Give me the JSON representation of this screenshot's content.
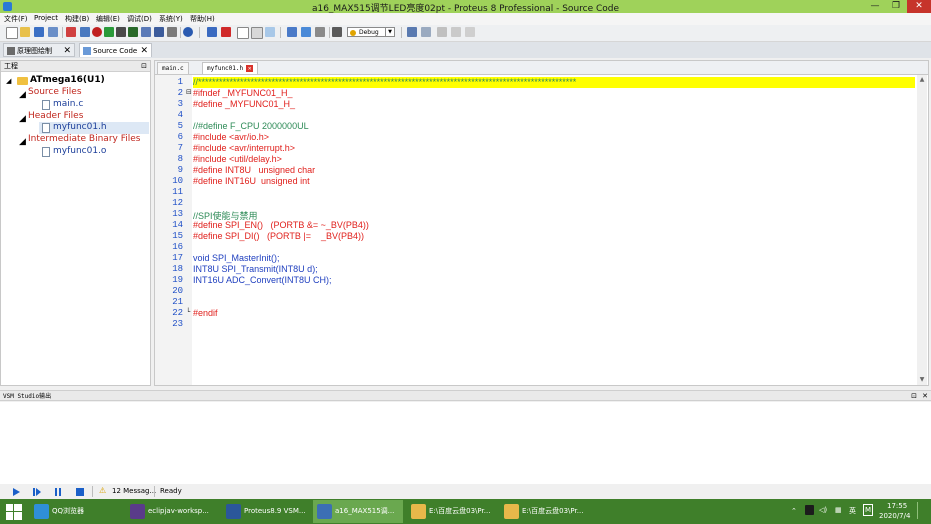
{
  "window": {
    "title": "a16_MAX515调节LED亮度02pt - Proteus 8 Professional - Source Code",
    "minimize": "—",
    "maximize": "❐",
    "close": "✕"
  },
  "menu": [
    "文件(F)",
    "Project",
    "构建(B)",
    "编辑(E)",
    "调试(D)",
    "系统(Y)",
    "帮助(H)"
  ],
  "toolbar": {
    "config": "Debug"
  },
  "doc_tabs": [
    {
      "label": "原理图绘制",
      "close": "✕"
    },
    {
      "label": "Source Code",
      "close": "✕"
    }
  ],
  "project": {
    "header": "工程",
    "pin": "⊡",
    "root": "ATmega16(U1)",
    "groups": [
      {
        "label": "Source Files",
        "files": [
          "main.c"
        ]
      },
      {
        "label": "Header Files",
        "files": [
          "myfunc01.h"
        ]
      },
      {
        "label": "Intermediate Binary Files",
        "files": [
          "myfunc01.o"
        ]
      }
    ]
  },
  "editor": {
    "tabs": [
      {
        "label": "main.c"
      },
      {
        "label": "myfunc01.h",
        "close": "✕"
      }
    ],
    "lines": [
      {
        "n": "1",
        "text": "//************************************************************************************************************",
        "color": "#2e8b57"
      },
      {
        "n": "2",
        "text": "#ifndef _MYFUNC01_H_",
        "color": "#e0201c"
      },
      {
        "n": "3",
        "text": "#define _MYFUNC01_H_",
        "color": "#e0201c"
      },
      {
        "n": "4",
        "text": "",
        "color": "#000000"
      },
      {
        "n": "5",
        "text": "//#define F_CPU 2000000UL",
        "color": "#2e8b57"
      },
      {
        "n": "6",
        "text": "#include <avr/io.h>",
        "color": "#e0201c"
      },
      {
        "n": "7",
        "text": "#include <avr/interrupt.h>",
        "color": "#e0201c"
      },
      {
        "n": "8",
        "text": "#include <util/delay.h>",
        "color": "#e0201c"
      },
      {
        "n": "9",
        "text": "#define INT8U   unsigned char",
        "color": "#e0201c"
      },
      {
        "n": "10",
        "text": "#define INT16U  unsigned int",
        "color": "#e0201c"
      },
      {
        "n": "11",
        "text": "",
        "color": "#000000"
      },
      {
        "n": "12",
        "text": "",
        "color": "#000000"
      },
      {
        "n": "13",
        "text": "//SPI使能与禁用",
        "color": "#2e8b57"
      },
      {
        "n": "14",
        "text": "#define SPI_EN()   (PORTB &= ~_BV(PB4))",
        "color": "#e0201c"
      },
      {
        "n": "15",
        "text": "#define SPI_DI()   (PORTB |=    _BV(PB4))",
        "color": "#e0201c"
      },
      {
        "n": "16",
        "text": "",
        "color": "#000000"
      },
      {
        "n": "17",
        "text": "void SPI_MasterInit();",
        "color": "#1f3fbf"
      },
      {
        "n": "18",
        "text": "INT8U SPI_Transmit(INT8U d);",
        "color": "#1f3fbf"
      },
      {
        "n": "19",
        "text": "INT16U ADC_Convert(INT8U CH);",
        "color": "#1f3fbf"
      },
      {
        "n": "20",
        "text": "",
        "color": "#000000"
      },
      {
        "n": "21",
        "text": "",
        "color": "#000000"
      },
      {
        "n": "22",
        "text": "#endif",
        "color": "#e0201c"
      },
      {
        "n": "23",
        "text": "",
        "color": "#000000"
      }
    ],
    "highlight_line": 1,
    "folds": [
      {
        "line": 2,
        "symbol": "⊟"
      },
      {
        "line": 22,
        "symbol": "└"
      }
    ],
    "scroll_up": "▲",
    "scroll_down": "▼"
  },
  "output": {
    "title": "VSM Studio输出",
    "pin": "⊡",
    "close": "✕"
  },
  "status": {
    "messages": "12 Messag...",
    "state": "Ready",
    "warning_symbol": "⚠"
  },
  "taskbar": {
    "tasks": [
      {
        "label": "QQ浏览器",
        "color": "#2f8fd8"
      },
      {
        "label": "eclipjav-worksp...",
        "color": "#5a3b8a"
      },
      {
        "label": "Proteus8.9 VSM...",
        "color": "#2b579a"
      },
      {
        "label": "a16_MAX515调...",
        "color": "#3c6fb4"
      },
      {
        "label": "E:\\百度云盘03\\Pr...",
        "color": "#e8b84a"
      },
      {
        "label": "E:\\百度云盘03\\Pr...",
        "color": "#e8b84a"
      }
    ],
    "tray": {
      "lang": "英",
      "ime": "M",
      "time": "17:55",
      "date": "2020/7/4"
    }
  },
  "colors": {
    "titlebar": "#9fd25a",
    "taskbar": "#3f7f2a",
    "highlight": "#ffff00",
    "line_numbers": "#1f4fc7"
  }
}
